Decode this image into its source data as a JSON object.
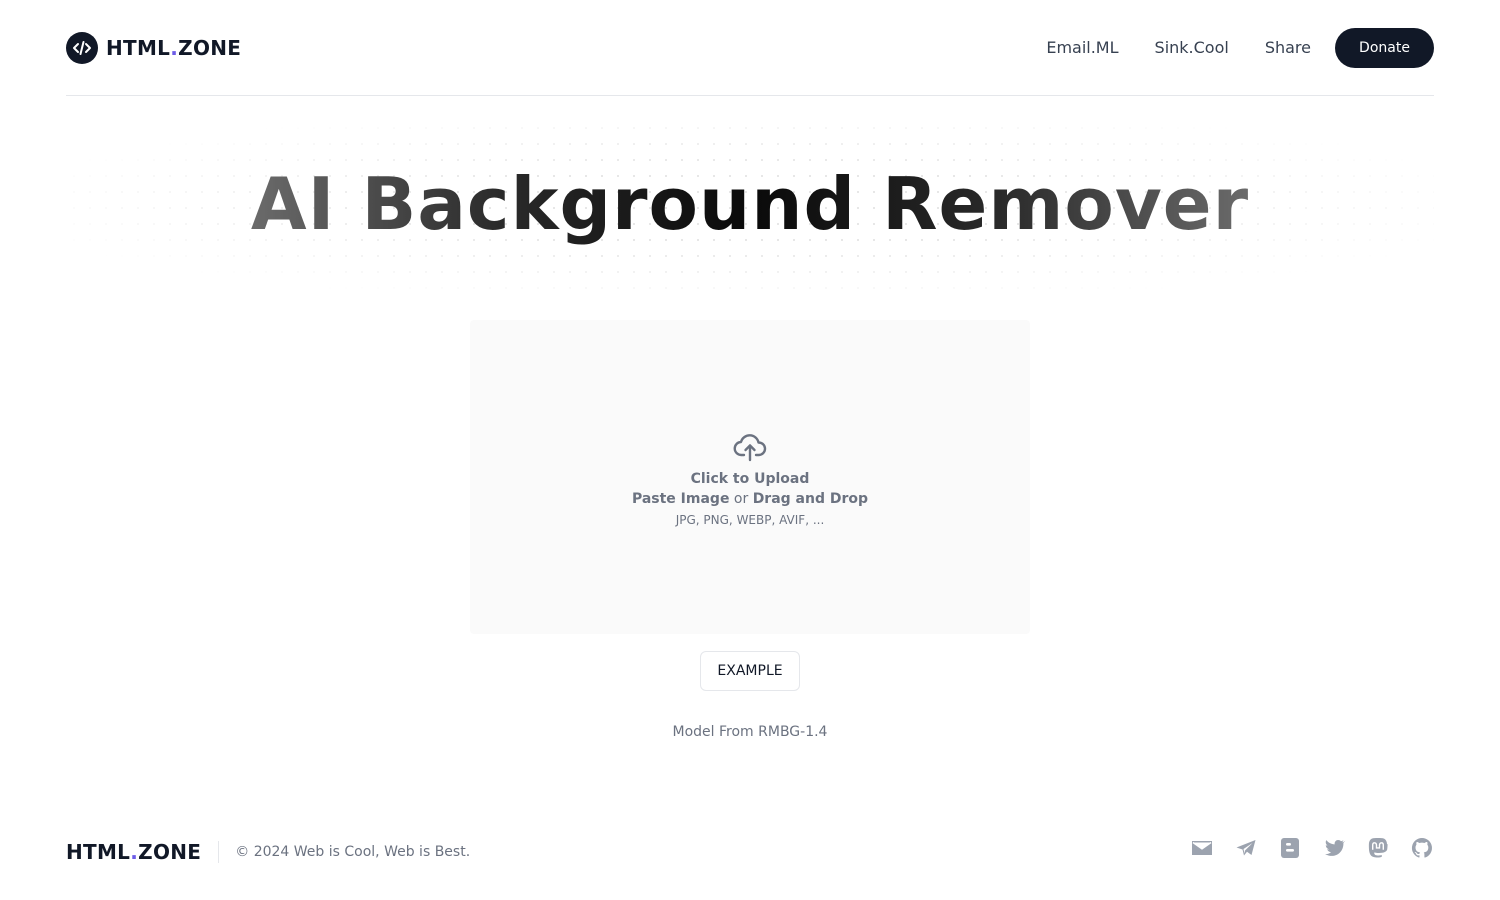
{
  "header": {
    "brand": {
      "name": "HTML",
      "dot": ".",
      "suffix": "ZONE",
      "icon": "code-icon"
    },
    "nav": [
      {
        "label": "Email.ML"
      },
      {
        "label": "Sink.Cool"
      },
      {
        "label": "Share"
      }
    ],
    "donate_label": "Donate"
  },
  "hero": {
    "title": "AI Background Remover"
  },
  "upload": {
    "icon": "cloud-upload-icon",
    "line1": "Click to Upload",
    "paste": "Paste Image",
    "or": "or",
    "drag": "Drag and Drop",
    "formats": "JPG, PNG, WEBP, AVIF, ..."
  },
  "example_label": "EXAMPLE",
  "model_note": "Model From RMBG-1.4",
  "footer": {
    "brand": {
      "name": "HTML",
      "dot": ".",
      "suffix": "ZONE"
    },
    "copyright": "© 2024 Web is Cool, Web is Best.",
    "socials": [
      {
        "icon": "mail-icon"
      },
      {
        "icon": "telegram-icon"
      },
      {
        "icon": "blogger-icon"
      },
      {
        "icon": "twitter-icon"
      },
      {
        "icon": "mastodon-icon"
      },
      {
        "icon": "github-icon"
      }
    ]
  },
  "colors": {
    "primary": "#111827",
    "accent_dot": "#6d5ce7",
    "muted": "#6b7280",
    "icon_gray": "#9ca3af",
    "dropzone_bg": "#fafafa"
  }
}
